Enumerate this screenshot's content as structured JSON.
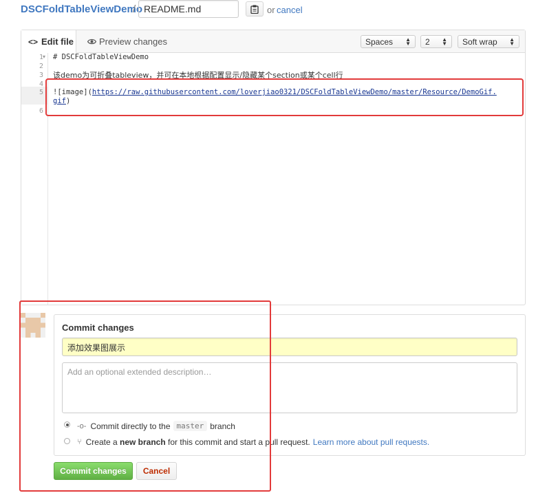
{
  "breadcrumb": {
    "repo": "DSCFoldTableViewDemo",
    "separator": "/",
    "filename": "README.md",
    "or": "or",
    "cancel": "cancel"
  },
  "editor": {
    "tabs": {
      "edit": "Edit file",
      "preview": "Preview changes"
    },
    "indent_mode": "Spaces",
    "indent_size": "2",
    "wrap_mode": "Soft wrap",
    "line_numbers": [
      "1",
      "2",
      "3",
      "4",
      "5",
      "6"
    ],
    "lines": {
      "l1": "# DSCFoldTableViewDemo",
      "l3": "该demo为可折叠tableview，并可在本地根据配置显示/隐藏某个section或某个cell行",
      "l5_prefix": "![image](",
      "l5_url_a": "https://raw.githubusercontent.com/loverjiao0321/DSCFoldTableViewDemo/master/Resource/DemoGif.",
      "l5_url_b": "gif",
      "l5_suffix": ")"
    }
  },
  "commit": {
    "title": "Commit changes",
    "summary_value": "添加效果图展示",
    "description_placeholder": "Add an optional extended description…",
    "option_direct": {
      "prefix": "Commit directly to the",
      "branch": "master",
      "suffix": "branch",
      "selected": true
    },
    "option_new": {
      "prefix": "Create a",
      "bold": "new branch",
      "suffix": "for this commit and start a pull request.",
      "link": "Learn more about pull requests.",
      "selected": false
    },
    "commit_button": "Commit changes",
    "cancel_button": "Cancel"
  },
  "colors": {
    "link": "#4078c0",
    "highlight": "#e23a3a",
    "commit_green": "#60b044",
    "summary_bg": "#ffffc6"
  }
}
